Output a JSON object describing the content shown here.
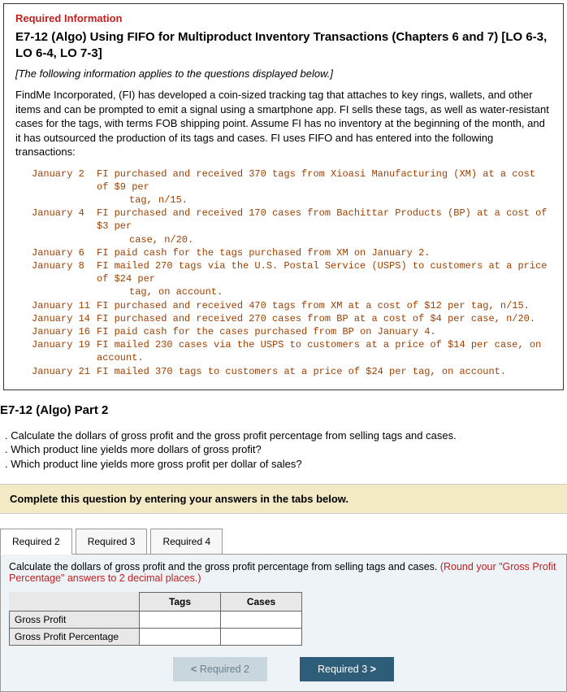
{
  "card": {
    "req_info": "Required Information",
    "title": "E7-12 (Algo) Using FIFO for Multiproduct Inventory Transactions (Chapters 6 and 7) [LO 6-3, LO 6-4, LO 7-3]",
    "applies": "[The following information applies to the questions displayed below.]",
    "para": "FindMe Incorporated, (FI) has developed a coin-sized tracking tag that attaches to key rings, wallets, and other items and can be prompted to emit a signal using a smartphone app. FI sells these tags, as well as water-resistant cases for the tags, with terms FOB shipping point. Assume FI has no inventory at the beginning of the month, and it has outsourced the production of its tags and cases. FI uses FIFO and has entered into the following transactions:",
    "tx": [
      {
        "date": "January 2",
        "body": "FI purchased and received 370 tags from Xioasi Manufacturing (XM) at a cost of $9 per",
        "cont": "tag, n/15."
      },
      {
        "date": "January 4",
        "body": "FI purchased and received 170 cases from Bachittar Products (BP) at a cost of $3 per",
        "cont": "case, n/20."
      },
      {
        "date": "January 6",
        "body": "FI paid cash for the tags purchased from XM on January 2.",
        "cont": ""
      },
      {
        "date": "January 8",
        "body": "FI mailed 270 tags via the U.S. Postal Service (USPS) to customers at a price of $24 per",
        "cont": "tag, on account."
      },
      {
        "date": "January 11",
        "body": "FI purchased and received 470 tags from XM at a cost of $12 per tag, n/15.",
        "cont": ""
      },
      {
        "date": "January 14",
        "body": "FI purchased and received 270 cases from BP at a cost of $4 per case, n/20.",
        "cont": ""
      },
      {
        "date": "January 16",
        "body": "FI paid cash for the cases purchased from BP on January 4.",
        "cont": ""
      },
      {
        "date": "January 19",
        "body": "FI mailed 230 cases via the USPS to customers at a price of $14 per case, on account.",
        "cont": ""
      },
      {
        "date": "January 21",
        "body": "FI mailed 370 tags to customers at a price of $24 per tag, on account.",
        "cont": ""
      }
    ]
  },
  "part_title": "E7-12 (Algo) Part 2",
  "questions": {
    "q1": ". Calculate the dollars of gross profit and the gross profit percentage from selling tags and cases.",
    "q2": ". Which product line yields more dollars of gross profit?",
    "q3": ". Which product line yields more gross profit per dollar of sales?"
  },
  "complete_bar": "Complete this question by entering your answers in the tabs below.",
  "tabs": {
    "r2": "Required 2",
    "r3": "Required 3",
    "r4": "Required 4"
  },
  "tab_content": {
    "instr_main": "Calculate the dollars of gross profit and the gross profit percentage from selling tags and cases. ",
    "instr_red": "(Round your \"Gross Profit Percentage\" answers to 2 decimal places.)",
    "col_tags": "Tags",
    "col_cases": "Cases",
    "row_gp": "Gross Profit",
    "row_gpp": "Gross Profit Percentage"
  },
  "nav": {
    "prev_chev": "<",
    "prev": "Required 2",
    "next": "Required 3",
    "next_chev": ">"
  }
}
